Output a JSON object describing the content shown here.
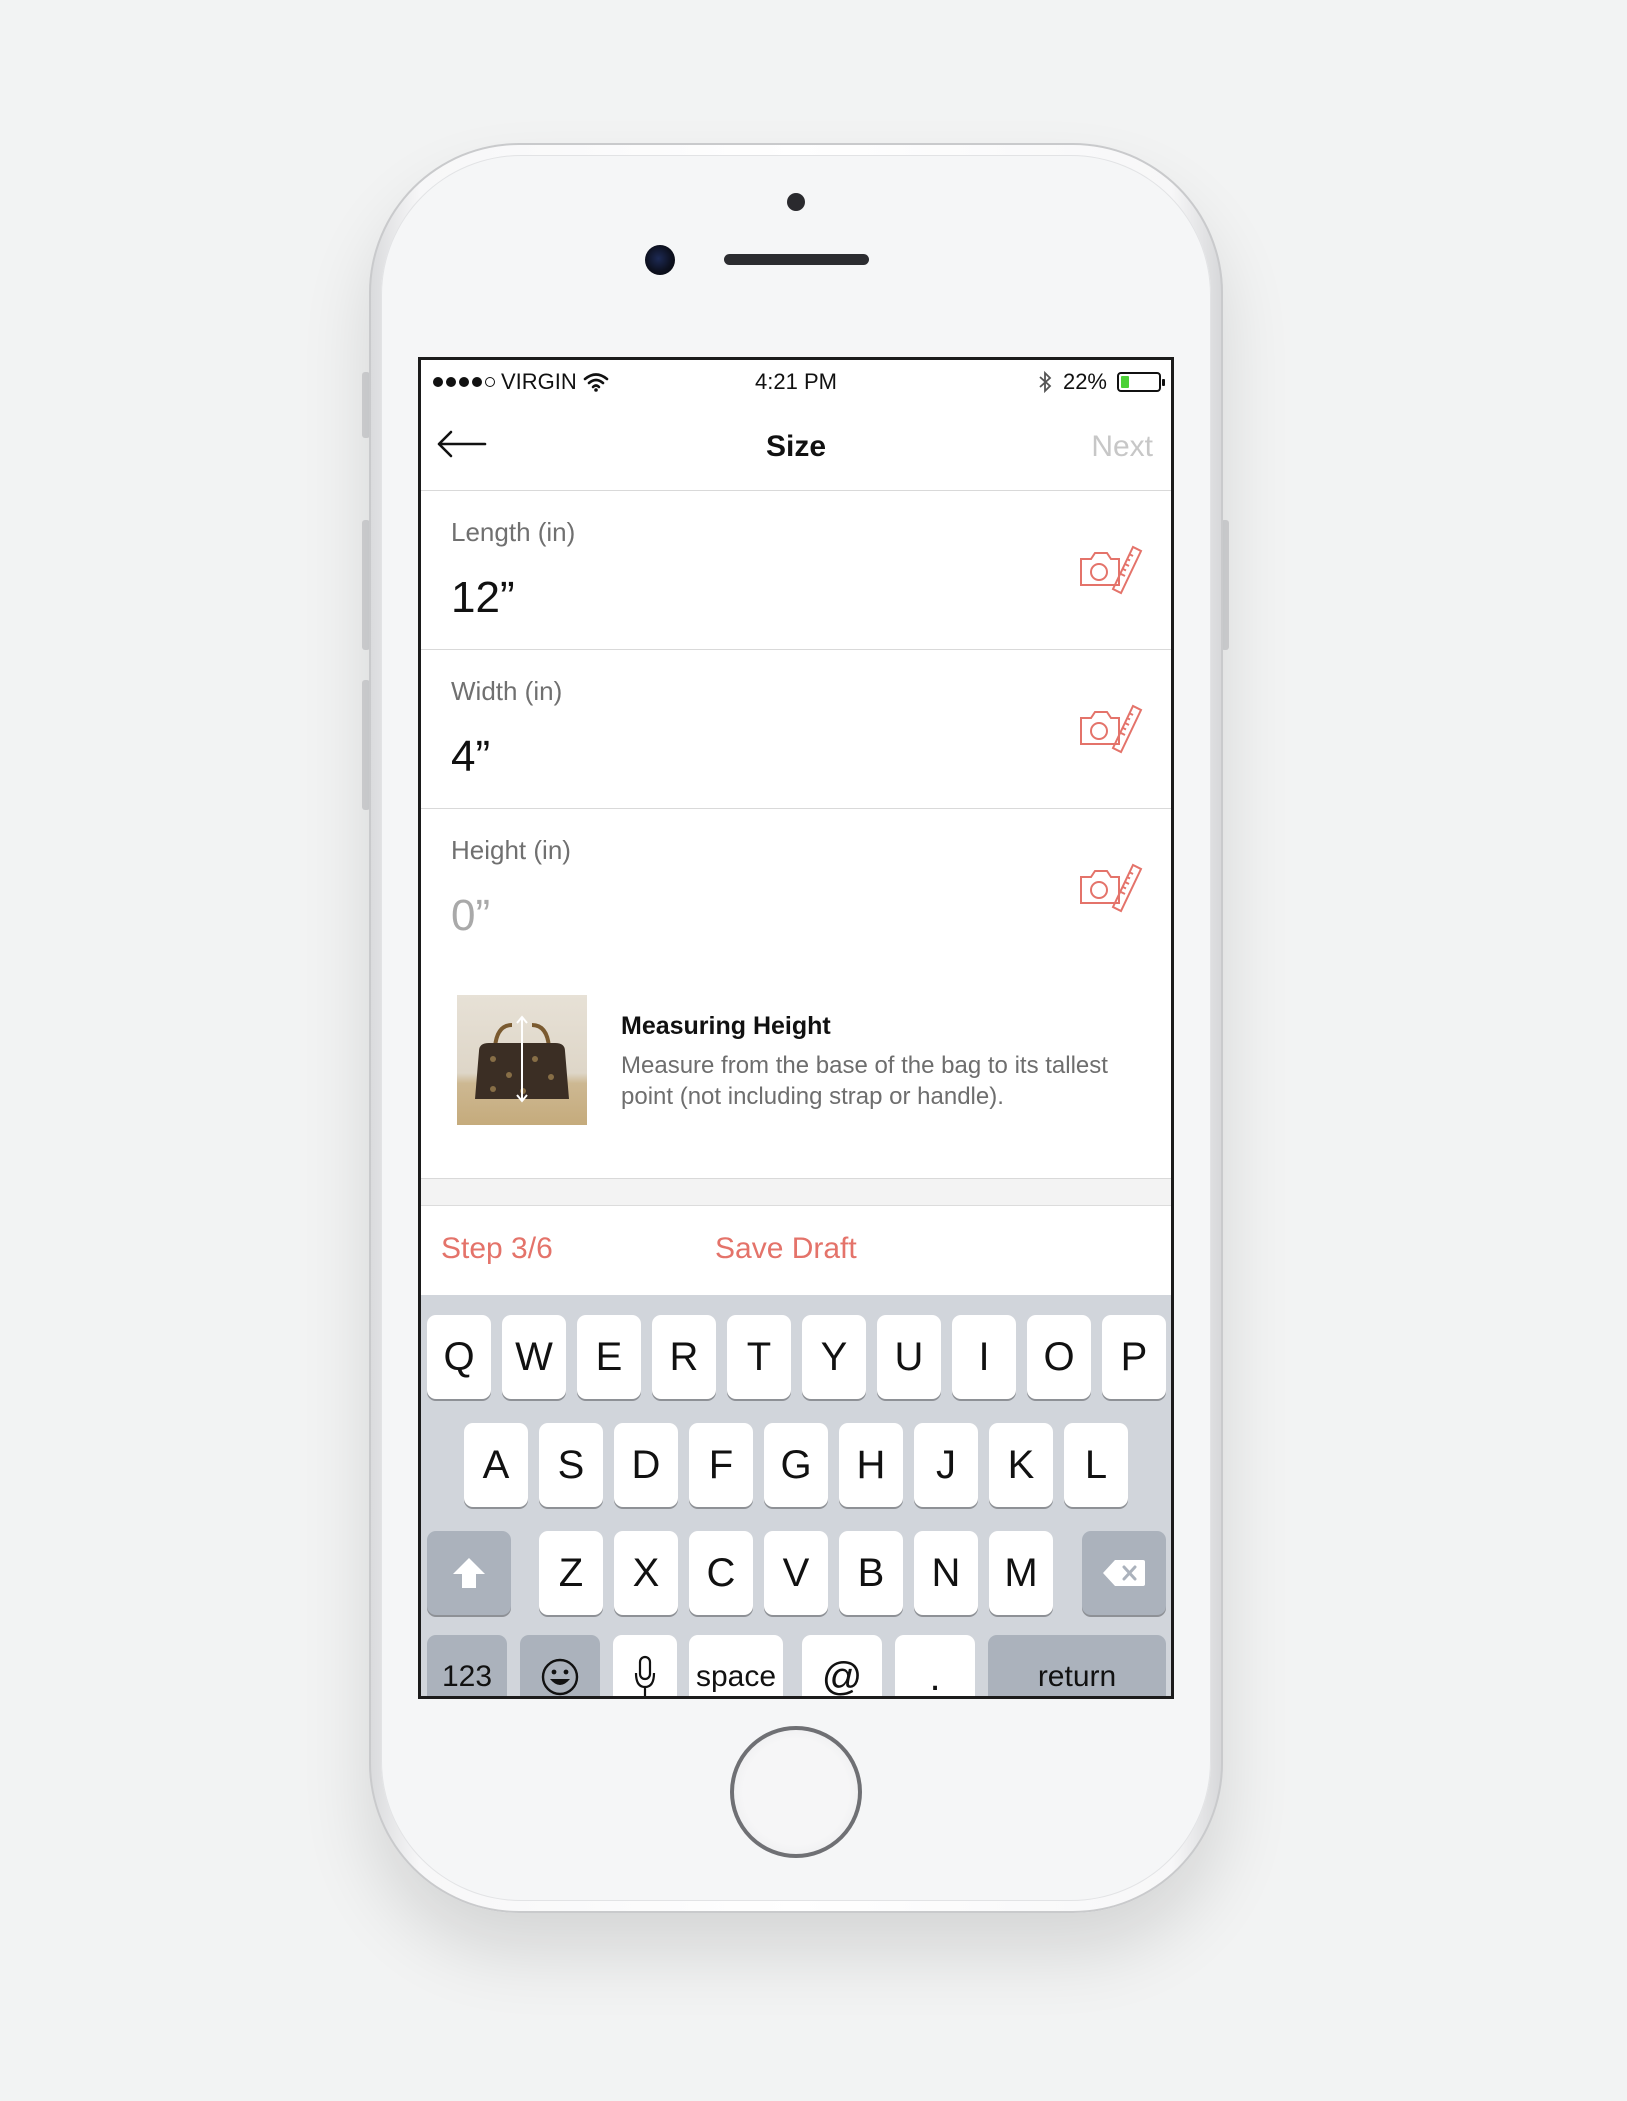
{
  "status_bar": {
    "carrier": "VIRGIN",
    "time": "4:21 PM",
    "battery_text": "22%",
    "battery_level": 0.22,
    "battery_color": "#4cd137"
  },
  "nav": {
    "back_icon": "arrow-left-icon",
    "title": "Size",
    "next_label": "Next"
  },
  "fields": [
    {
      "label": "Length (in)",
      "value": "12”",
      "is_placeholder": false,
      "icon": "camera-ruler-icon"
    },
    {
      "label": "Width (in)",
      "value": "4”",
      "is_placeholder": false,
      "icon": "camera-ruler-icon"
    },
    {
      "label": "Height (in)",
      "value": "0”",
      "is_placeholder": true,
      "icon": "camera-ruler-icon"
    }
  ],
  "help": {
    "title": "Measuring Height",
    "text": "Measure from the base of the bag to its tallest point (not including strap or handle)."
  },
  "footer": {
    "step": "Step 3/6",
    "save_draft": "Save Draft",
    "accent_color": "#e4736a"
  },
  "keyboard": {
    "row1": [
      "Q",
      "W",
      "E",
      "R",
      "T",
      "Y",
      "U",
      "I",
      "O",
      "P"
    ],
    "row2": [
      "A",
      "S",
      "D",
      "F",
      "G",
      "H",
      "J",
      "K",
      "L"
    ],
    "row3": [
      "Z",
      "X",
      "C",
      "V",
      "B",
      "N",
      "M"
    ],
    "numbers": "123",
    "space": "space",
    "at": "@",
    "dot": ".",
    "return": "return",
    "shift_icon": "shift-icon",
    "delete_icon": "delete-icon",
    "emoji_icon": "emoji-icon",
    "mic_icon": "microphone-icon"
  }
}
